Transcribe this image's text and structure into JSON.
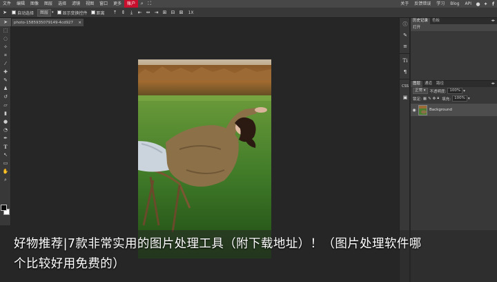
{
  "menubar": {
    "items": [
      "文件",
      "编辑",
      "图像",
      "图层",
      "选择",
      "滤镜",
      "视图",
      "窗口",
      "更多"
    ],
    "account": "账户",
    "right_items": [
      "关于",
      "反馈错误",
      "学习",
      "Blog",
      "API"
    ],
    "right_icons": [
      "reddit-icon",
      "twitter-icon",
      "facebook-icon"
    ]
  },
  "optbar": {
    "auto_select": "自动选择",
    "target": "图层",
    "show_transform": "显示变换控件",
    "distance": "距离",
    "zoom_label": "1X"
  },
  "document": {
    "tab_title": "photo-1585935079149-4cd927",
    "close": "×"
  },
  "history_panel": {
    "tabs": [
      "历史记录",
      "色板"
    ],
    "entries": [
      "打开"
    ]
  },
  "layers_panel": {
    "tabs": [
      "图层",
      "通道",
      "路径"
    ],
    "blend_mode": "正常",
    "opacity_label": "不透明度:",
    "opacity_value": "100%",
    "lock_label": "锁定:",
    "fill_label": "填充:",
    "fill_value": "100%",
    "layers": [
      {
        "name": "Background"
      }
    ]
  },
  "right_column": {
    "css_label": "CSS"
  },
  "caption": {
    "line1": "好物推荐|7款非常实用的图片处理工具（附下载地址）！（图片处理软件哪",
    "line2": "个比较好用免费的）"
  },
  "colors": {
    "accent": "#c8102e",
    "foreground": "#0a0a0a",
    "background": "#ffffff"
  }
}
